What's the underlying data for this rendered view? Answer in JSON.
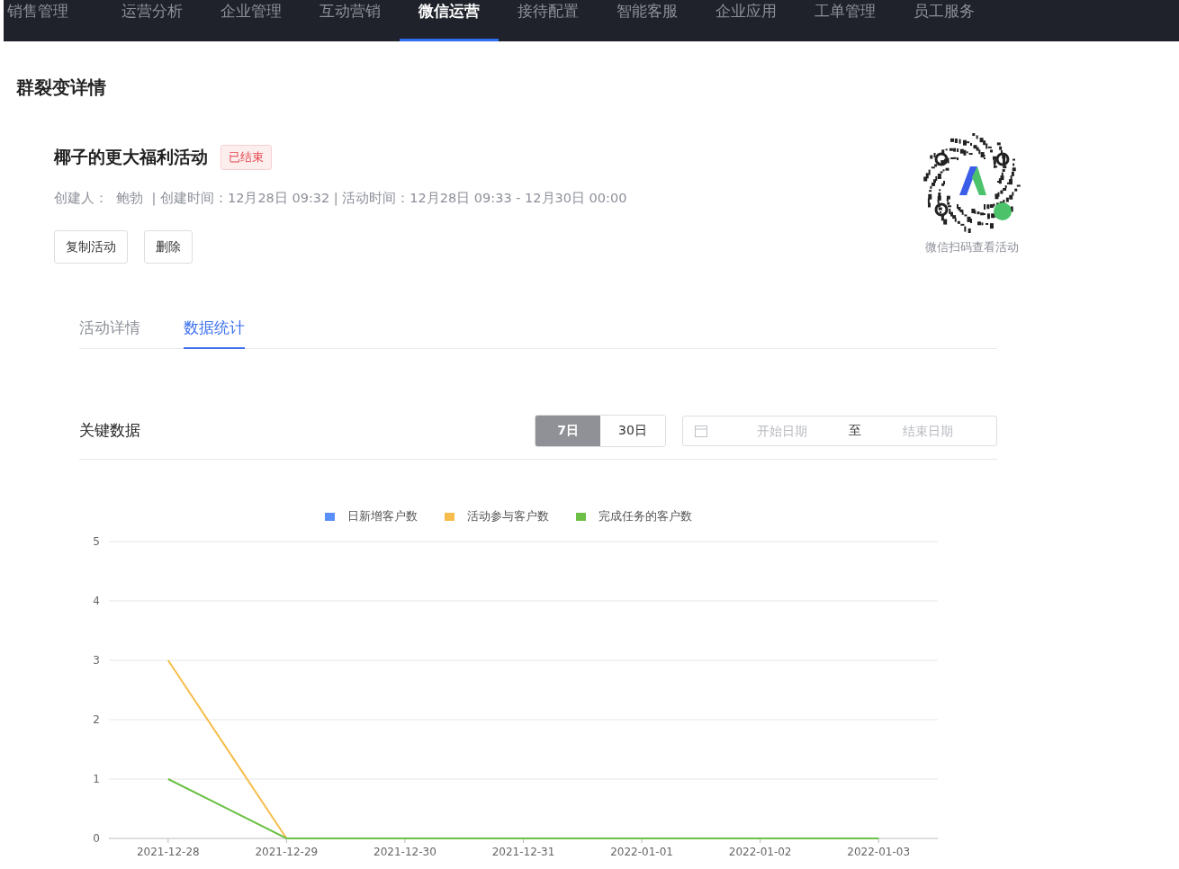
{
  "nav": {
    "items": [
      {
        "label": "销售管理",
        "selected": false
      },
      {
        "label": "运营分析",
        "selected": false
      },
      {
        "label": "企业管理",
        "selected": false
      },
      {
        "label": "互动营销",
        "selected": false
      },
      {
        "label": "微信运营",
        "selected": true
      },
      {
        "label": "接待配置",
        "selected": false
      },
      {
        "label": "智能客服",
        "selected": false
      },
      {
        "label": "企业应用",
        "selected": false
      },
      {
        "label": "工单管理",
        "selected": false
      },
      {
        "label": "员工服务",
        "selected": false
      }
    ]
  },
  "page_title": "群裂变详情",
  "activity": {
    "name": "椰子的更大福利活动",
    "status": "已结束",
    "meta": "创建人：  鲍勃  | 创建时间：12月28日 09:32 | 活动时间：12月28日 09:33 - 12月30日 00:00",
    "buttons": [
      "复制活动",
      "删除"
    ],
    "qr_caption": "微信扫码查看活动"
  },
  "tabs": [
    {
      "label": "活动详情",
      "selected": false
    },
    {
      "label": "数据统计",
      "selected": true
    }
  ],
  "key_data": {
    "title": "关键数据",
    "ranges": [
      {
        "label": "7日",
        "selected": true
      },
      {
        "label": "30日",
        "selected": false
      }
    ],
    "date_range": {
      "start_placeholder": "开始日期",
      "separator": "至",
      "end_placeholder": "结束日期"
    },
    "chart_data": {
      "type": "line",
      "categories": [
        "2021-12-28",
        "2021-12-29",
        "2021-12-30",
        "2021-12-31",
        "2022-01-01",
        "2022-01-02",
        "2022-01-03"
      ],
      "ylim": [
        0,
        5
      ],
      "grid": true,
      "yticks": [
        0,
        1,
        2,
        3,
        4,
        5
      ],
      "series": [
        {
          "name": "日新增客户数",
          "color": "#5b8ff9",
          "values": [
            null,
            null,
            null,
            null,
            null,
            null,
            null
          ]
        },
        {
          "name": "活动参与客户数",
          "color": "#f6bd4c",
          "values": [
            3,
            0,
            null,
            null,
            null,
            null,
            null
          ]
        },
        {
          "name": "完成任务的客户数",
          "color": "#6dc045",
          "values": [
            1,
            0,
            0,
            0,
            0,
            0,
            0
          ]
        }
      ]
    }
  }
}
